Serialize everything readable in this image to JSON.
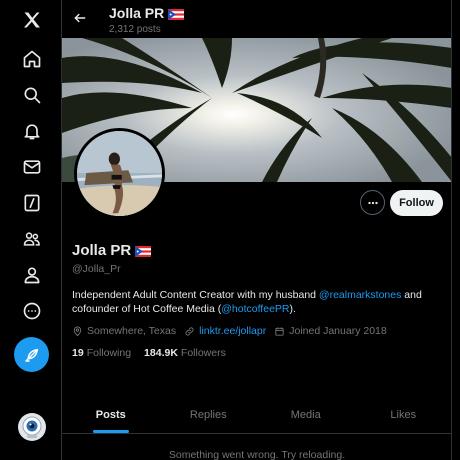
{
  "nav": {
    "items": [
      {
        "icon": "x-logo-icon"
      },
      {
        "icon": "home-icon"
      },
      {
        "icon": "search-icon"
      },
      {
        "icon": "bell-icon"
      },
      {
        "icon": "mail-icon"
      },
      {
        "icon": "grok-icon"
      },
      {
        "icon": "communities-icon"
      },
      {
        "icon": "profile-icon"
      },
      {
        "icon": "more-circle-icon"
      }
    ],
    "compose_icon": "feather-icon",
    "accent": "#1d9bf0"
  },
  "header": {
    "name": "Jolla PR",
    "post_count": "2,312 posts"
  },
  "profile": {
    "display_name": "Jolla PR",
    "flag_icon": "puerto-rico-flag-icon",
    "handle": "@Jolla_Pr",
    "follow_label": "Follow",
    "bio": {
      "part1": "Independent Adult Content Creator with my husband ",
      "mention1": "@realmarkstones",
      "part2": " and cofounder of Hot Coffee Media (",
      "mention2": "@hotcoffeePR",
      "part3": ")."
    },
    "location": "Somewhere, Texas",
    "link": "linktr.ee/jollapr",
    "joined": "Joined January 2018",
    "following_count": "19",
    "following_label": "Following",
    "followers_count": "184.9K",
    "followers_label": "Followers"
  },
  "tabs": [
    {
      "label": "Posts",
      "active": true
    },
    {
      "label": "Replies",
      "active": false
    },
    {
      "label": "Media",
      "active": false
    },
    {
      "label": "Likes",
      "active": false
    }
  ],
  "error_message": "Something went wrong. Try reloading."
}
